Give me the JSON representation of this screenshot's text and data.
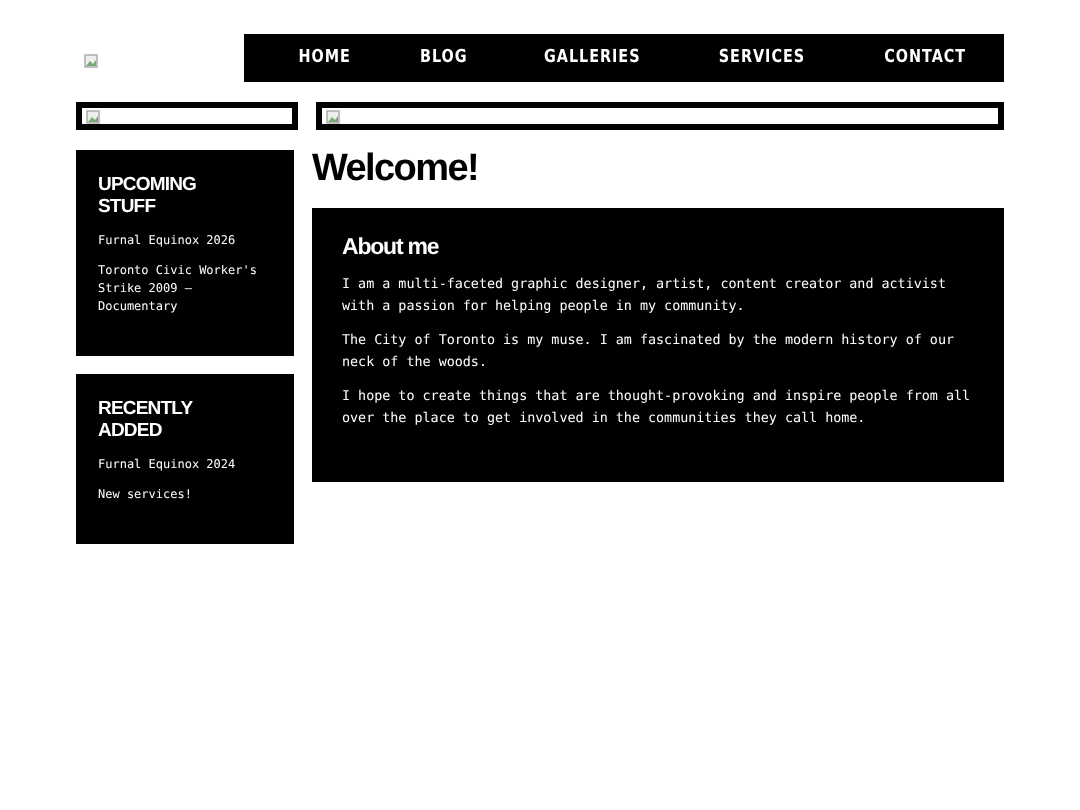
{
  "nav": {
    "items": [
      "HOME",
      "BLOG",
      "GALLERIES",
      "SERVICES",
      "CONTACT"
    ]
  },
  "sidebar": [
    {
      "title": "UPCOMING STUFF",
      "entries": [
        "Furnal Equinox 2026",
        "Toronto Civic Worker's Strike 2009 – Documentary"
      ]
    },
    {
      "title": "RECENTLY ADDED",
      "entries": [
        "Furnal Equinox 2024",
        "New services!"
      ]
    }
  ],
  "main": {
    "heading": "Welcome!",
    "card": {
      "title": "About me",
      "paragraphs": [
        "I am a multi-faceted graphic designer, artist, content creator and activist with a passion for helping people in my community.",
        "The City of Toronto is my muse. I am fascinated by the modern history of our neck of the woods.",
        "I hope to create things that are thought-provoking and inspire people from all over the place to get involved in the communities they call home."
      ]
    }
  }
}
